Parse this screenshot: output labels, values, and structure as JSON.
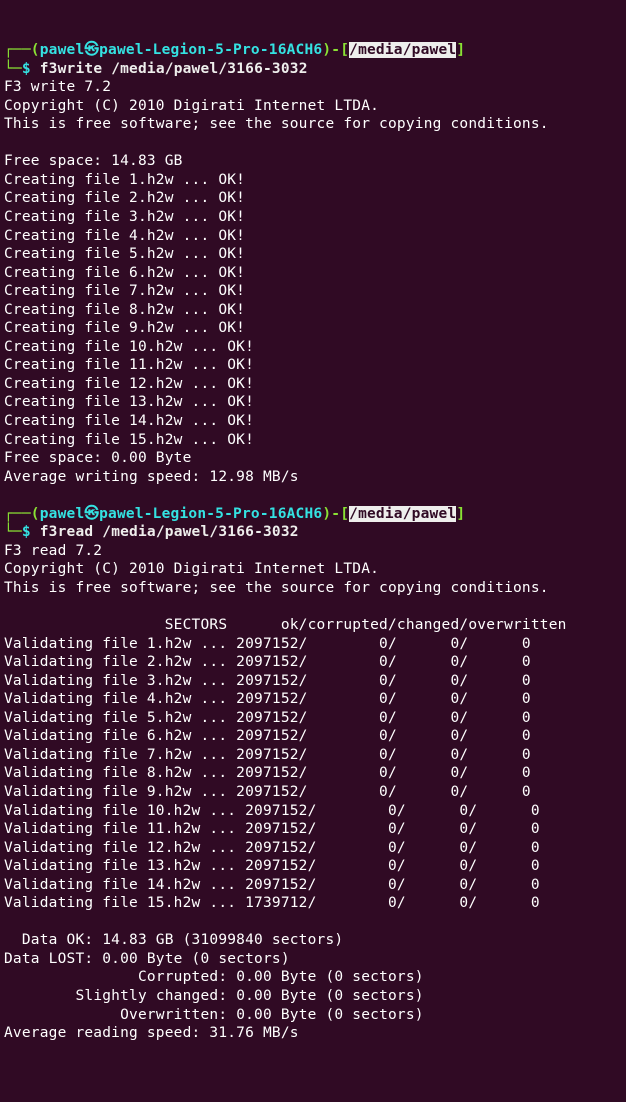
{
  "prompt1": {
    "corner": "┌──(",
    "user": "pawel",
    "icon": "㉿",
    "host": "pawel-Legion-5-Pro-16ACH6",
    "mid": ")-[",
    "cwd": "/media/pawel",
    "end": "]",
    "line2_corner": "└─",
    "dollar": "$ ",
    "command": "f3write /media/pawel/3166-3032"
  },
  "write_header": {
    "l1": "F3 write 7.2",
    "l2": "Copyright (C) 2010 Digirati Internet LTDA.",
    "l3": "This is free software; see the source for copying conditions."
  },
  "free_space_before": "Free space: 14.83 GB",
  "create_lines": [
    "Creating file 1.h2w ... OK!",
    "Creating file 2.h2w ... OK!",
    "Creating file 3.h2w ... OK!",
    "Creating file 4.h2w ... OK!",
    "Creating file 5.h2w ... OK!",
    "Creating file 6.h2w ... OK!",
    "Creating file 7.h2w ... OK!",
    "Creating file 8.h2w ... OK!",
    "Creating file 9.h2w ... OK!",
    "Creating file 10.h2w ... OK!",
    "Creating file 11.h2w ... OK!",
    "Creating file 12.h2w ... OK!",
    "Creating file 13.h2w ... OK!",
    "Creating file 14.h2w ... OK!",
    "Creating file 15.h2w ... OK!"
  ],
  "free_space_after": "Free space: 0.00 Byte",
  "avg_write": "Average writing speed: 12.98 MB/s",
  "prompt2": {
    "corner": "┌──(",
    "user": "pawel",
    "icon": "㉿",
    "host": "pawel-Legion-5-Pro-16ACH6",
    "mid": ")-[",
    "cwd": "/media/pawel",
    "end": "]",
    "line2_corner": "└─",
    "dollar": "$ ",
    "command": "f3read /media/pawel/3166-3032"
  },
  "read_header": {
    "l1": "F3 read 7.2",
    "l2": "Copyright (C) 2010 Digirati Internet LTDA.",
    "l3": "This is free software; see the source for copying conditions."
  },
  "sectors_header": "                  SECTORS      ok/corrupted/changed/overwritten",
  "validate_lines": [
    "Validating file 1.h2w ... 2097152/        0/      0/      0",
    "Validating file 2.h2w ... 2097152/        0/      0/      0",
    "Validating file 3.h2w ... 2097152/        0/      0/      0",
    "Validating file 4.h2w ... 2097152/        0/      0/      0",
    "Validating file 5.h2w ... 2097152/        0/      0/      0",
    "Validating file 6.h2w ... 2097152/        0/      0/      0",
    "Validating file 7.h2w ... 2097152/        0/      0/      0",
    "Validating file 8.h2w ... 2097152/        0/      0/      0",
    "Validating file 9.h2w ... 2097152/        0/      0/      0",
    "Validating file 10.h2w ... 2097152/        0/      0/      0",
    "Validating file 11.h2w ... 2097152/        0/      0/      0",
    "Validating file 12.h2w ... 2097152/        0/      0/      0",
    "Validating file 13.h2w ... 2097152/        0/      0/      0",
    "Validating file 14.h2w ... 2097152/        0/      0/      0",
    "Validating file 15.h2w ... 1739712/        0/      0/      0"
  ],
  "summary": {
    "data_ok": "  Data OK: 14.83 GB (31099840 sectors)",
    "data_lost": "Data LOST: 0.00 Byte (0 sectors)",
    "corrupted": "\t       Corrupted: 0.00 Byte (0 sectors)",
    "slightly": "\tSlightly changed: 0.00 Byte (0 sectors)",
    "overwritten": "\t     Overwritten: 0.00 Byte (0 sectors)",
    "avg_read": "Average reading speed: 31.76 MB/s"
  }
}
